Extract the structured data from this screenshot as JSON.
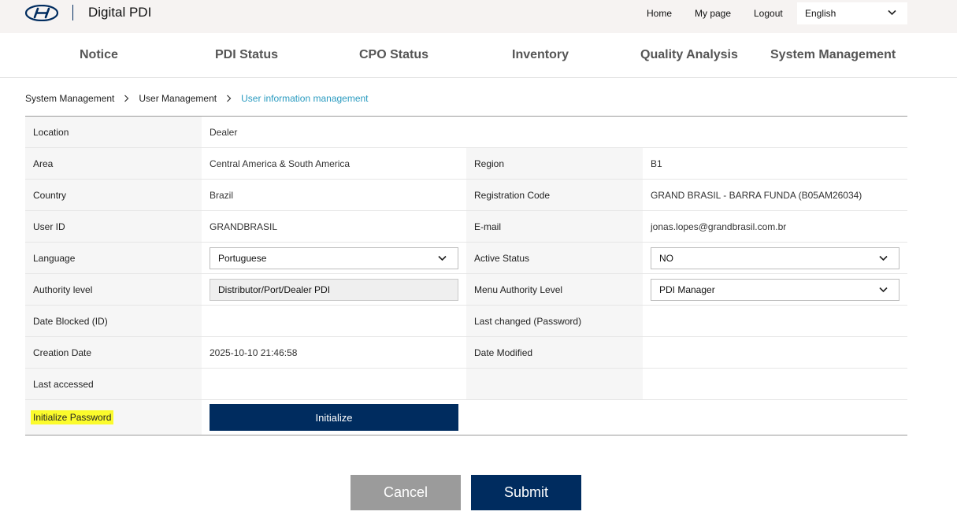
{
  "header": {
    "app_title": "Digital PDI",
    "links": {
      "home": "Home",
      "mypage": "My page",
      "logout": "Logout"
    },
    "language": "English"
  },
  "nav": [
    "Notice",
    "PDI Status",
    "CPO Status",
    "Inventory",
    "Quality Analysis",
    "System Management"
  ],
  "breadcrumb": [
    "System Management",
    "User Management",
    "User information management"
  ],
  "form": {
    "location_label": "Location",
    "location_value": "Dealer",
    "area_label": "Area",
    "area_value": "Central America & South America",
    "region_label": "Region",
    "region_value": "B1",
    "country_label": "Country",
    "country_value": "Brazil",
    "regcode_label": "Registration Code",
    "regcode_value": "GRAND BRASIL - BARRA FUNDA (B05AM26034)",
    "userid_label": "User ID",
    "userid_value": "GRANDBRASIL",
    "email_label": "E-mail",
    "email_value": "jonas.lopes@grandbrasil.com.br",
    "language_label": "Language",
    "language_value": "Portuguese",
    "active_label": "Active Status",
    "active_value": "NO",
    "authority_label": "Authority level",
    "authority_value": "Distributor/Port/Dealer PDI",
    "menu_authority_label": "Menu Authority Level",
    "menu_authority_value": "PDI Manager",
    "date_blocked_label": "Date Blocked (ID)",
    "date_blocked_value": "",
    "last_changed_label": "Last changed (Password)",
    "last_changed_value": "",
    "creation_label": "Creation Date",
    "creation_value": "2025-10-10 21:46:58",
    "modified_label": "Date Modified",
    "modified_value": "",
    "last_accessed_label": "Last accessed",
    "last_accessed_value": "",
    "init_pw_label": "Initialize Password",
    "init_button": "Initialize"
  },
  "actions": {
    "cancel": "Cancel",
    "submit": "Submit"
  },
  "colors": {
    "brand": "#002c5f",
    "accent": "#2a9bc0",
    "highlight": "#fbfb2c",
    "cancel": "#9b9b9b"
  }
}
